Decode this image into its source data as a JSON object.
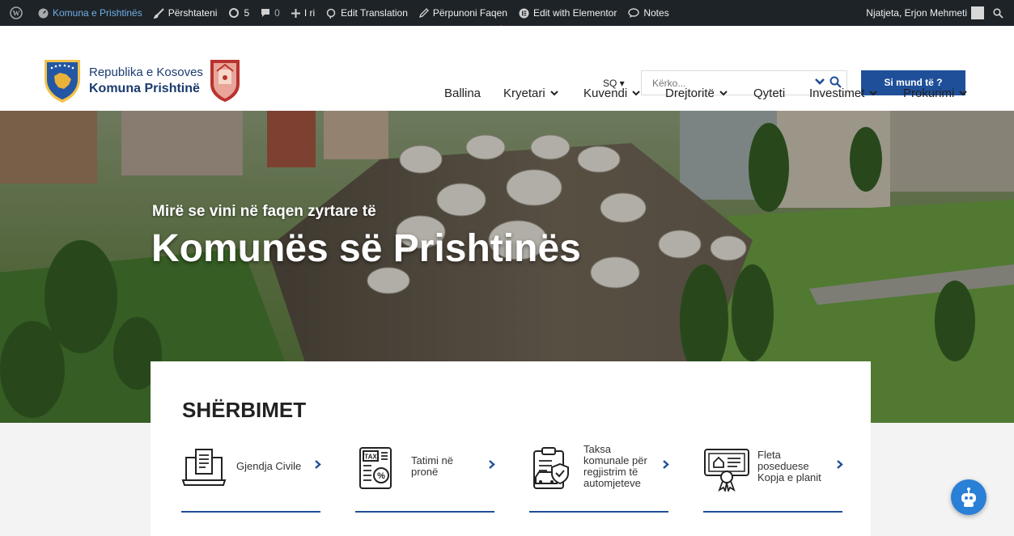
{
  "adminbar": {
    "site": "Komuna e Prishtinës",
    "customize": "Përshtateni",
    "updates": "5",
    "comments": "0",
    "new": "I ri",
    "translate": "Edit Translation",
    "edit_page": "Përpunoni Faqen",
    "elementor": "Edit with Elementor",
    "notes": "Notes",
    "greeting": "Njatjeta, Erjon Mehmeti"
  },
  "logo": {
    "line1": "Republika e Kosoves",
    "line2": "Komuna Prishtinë"
  },
  "header": {
    "lang": "SQ ▾",
    "search_placeholder": "Kërko...",
    "help_button": "Si mund të ?"
  },
  "nav": [
    "Ballina",
    "Kryetari",
    "Kuvendi",
    "Drejtoritë",
    "Qyteti",
    "Investimet",
    "Prokurimi"
  ],
  "hero": {
    "subtitle": "Mirë se vini në faqen zyrtare të",
    "title": "Komunës së Prishtinës"
  },
  "services": {
    "title": "SHËRBIMET",
    "items": [
      {
        "label": "Gjendja Civile",
        "icon": "computer-document-icon"
      },
      {
        "label": "Tatimi në pronë",
        "icon": "tax-icon"
      },
      {
        "label": "Taksa komunale për regjistrim të automjeteve",
        "icon": "vehicle-registration-icon"
      },
      {
        "label": "Fleta poseduese Kopja e planit",
        "icon": "certificate-icon"
      }
    ]
  },
  "colors": {
    "adminbar": "#1d2327",
    "brand": "#1f4f99",
    "chatbot": "#2a7fd6"
  }
}
